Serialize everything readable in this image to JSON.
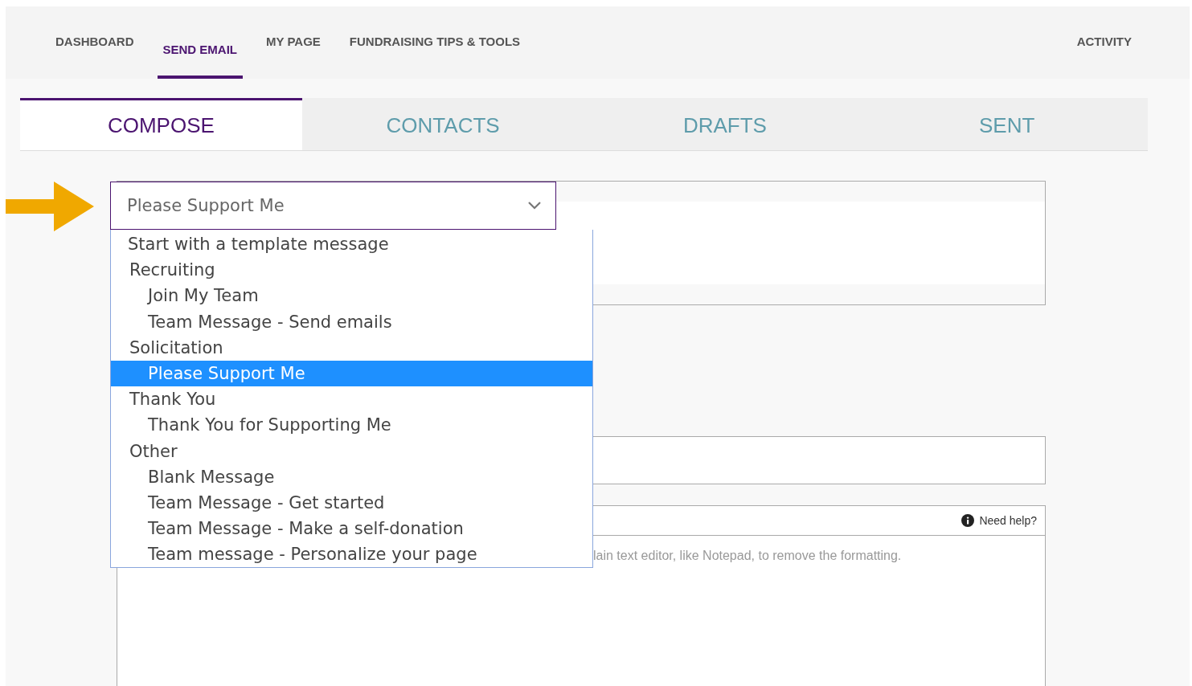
{
  "nav": {
    "items": [
      {
        "label": "DASHBOARD",
        "selected": false
      },
      {
        "label": "SEND EMAIL",
        "selected": true
      },
      {
        "label": "MY PAGE",
        "selected": false
      },
      {
        "label": "FUNDRAISING TIPS & TOOLS",
        "selected": false
      }
    ],
    "right_item": "ACTIVITY"
  },
  "tabs": [
    {
      "label": "COMPOSE",
      "selected": true
    },
    {
      "label": "CONTACTS",
      "selected": false
    },
    {
      "label": "DRAFTS",
      "selected": false
    },
    {
      "label": "SENT",
      "selected": false
    }
  ],
  "template_select": {
    "value": "Please Support Me",
    "expanded": true,
    "placeholder_option": "Start with a template message",
    "groups": [
      {
        "label": "Recruiting",
        "children": [
          {
            "label": "Join My Team",
            "selected": false
          },
          {
            "label": "Team Message - Send emails",
            "selected": false
          }
        ]
      },
      {
        "label": "Solicitation",
        "children": [
          {
            "label": "Please Support Me",
            "selected": true
          }
        ]
      },
      {
        "label": "Thank You",
        "children": [
          {
            "label": "Thank You for Supporting Me",
            "selected": false
          }
        ]
      },
      {
        "label": "Other",
        "children": [
          {
            "label": "Blank Message",
            "selected": false
          },
          {
            "label": "Team Message - Get started",
            "selected": false
          },
          {
            "label": "Team Message - Make a self-donation",
            "selected": false
          },
          {
            "label": "Team message - Personalize your page",
            "selected": false
          }
        ]
      }
    ]
  },
  "editor": {
    "help_link": "Need help?",
    "hint": "lain text editor, like Notepad, to remove the formatting."
  }
}
